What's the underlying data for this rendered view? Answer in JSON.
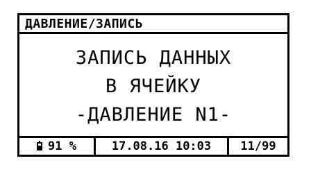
{
  "header": {
    "title": "ДАВЛЕНИЕ/ЗАПИСЬ"
  },
  "message": {
    "line1": "ЗАПИСЬ ДАННЫХ",
    "line2": "В ЯЧЕЙКУ",
    "line3": "-ДАВЛЕНИЕ N1-"
  },
  "status": {
    "battery_icon": "battery-icon",
    "battery_percent": "91 %",
    "datetime": "17.08.16 10:03",
    "counter": "11/99"
  }
}
